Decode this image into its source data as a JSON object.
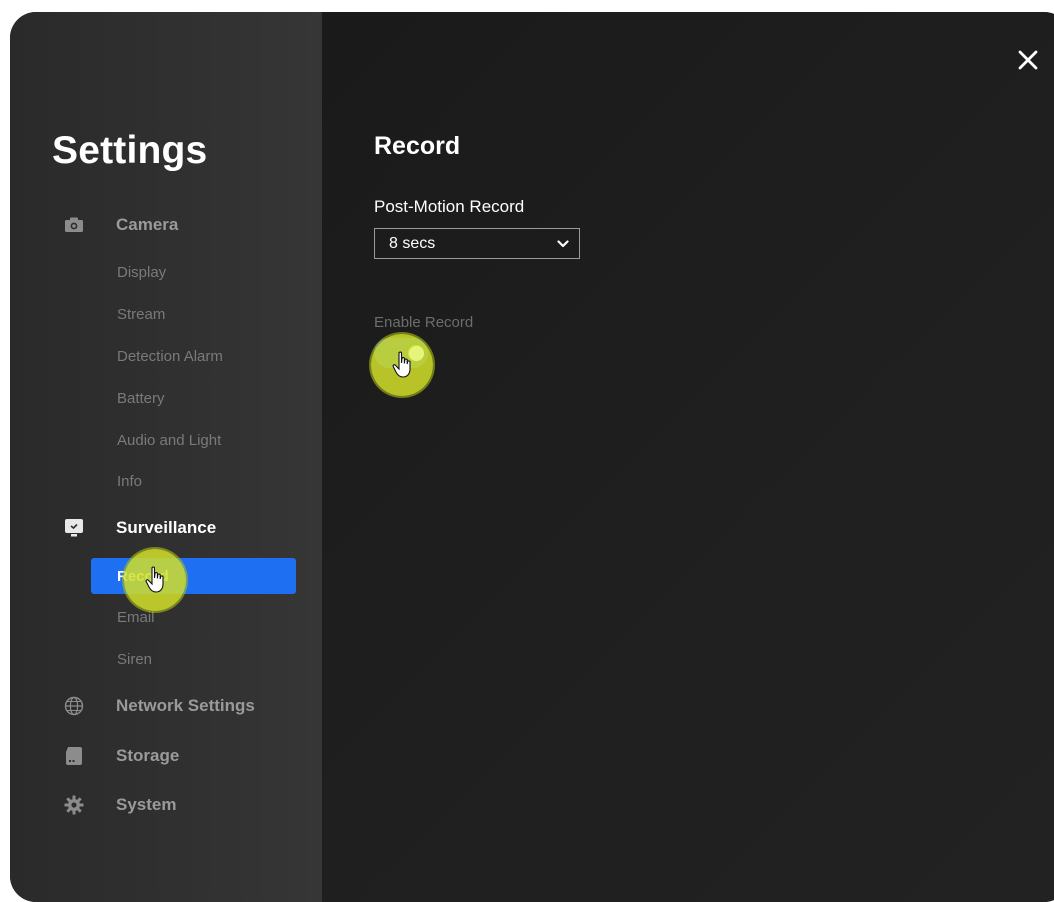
{
  "sidebar": {
    "title": "Settings",
    "sections": [
      {
        "label": "Camera",
        "icon": "camera-icon",
        "items": [
          "Display",
          "Stream",
          "Detection Alarm",
          "Battery",
          "Audio and Light",
          "Info"
        ]
      },
      {
        "label": "Surveillance",
        "icon": "monitor-icon",
        "items": [
          "Record",
          "Email",
          "Siren"
        ]
      },
      {
        "label": "Network Settings",
        "icon": "globe-icon"
      },
      {
        "label": "Storage",
        "icon": "sd-card-icon"
      },
      {
        "label": "System",
        "icon": "gear-icon"
      }
    ],
    "active_item": "Record",
    "active_color": "#1e6ff2"
  },
  "main": {
    "title": "Record",
    "post_motion": {
      "label": "Post-Motion Record",
      "value": "8 secs"
    },
    "enable_record": {
      "label": "Enable Record",
      "on": true
    }
  },
  "icons": {
    "close": "close-icon"
  }
}
